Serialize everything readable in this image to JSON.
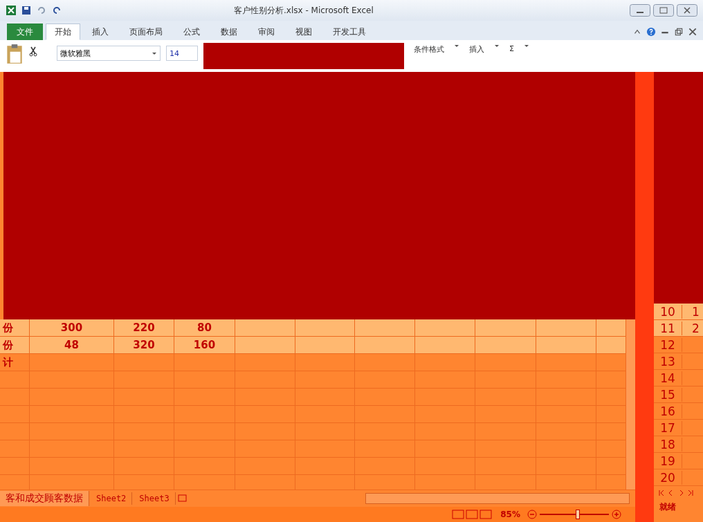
{
  "window": {
    "title": "客户性别分析.xlsx - Microsoft Excel"
  },
  "ribbon_tabs": [
    {
      "label": "文件",
      "kind": "file",
      "selected": false
    },
    {
      "label": "开始",
      "kind": "tab",
      "selected": true
    },
    {
      "label": "插入",
      "kind": "tab",
      "selected": false
    },
    {
      "label": "页面布局",
      "kind": "tab",
      "selected": false
    },
    {
      "label": "公式",
      "kind": "tab",
      "selected": false
    },
    {
      "label": "数据",
      "kind": "tab",
      "selected": false
    },
    {
      "label": "审阅",
      "kind": "tab",
      "selected": false
    },
    {
      "label": "视图",
      "kind": "tab",
      "selected": false
    },
    {
      "label": "开发工具",
      "kind": "tab",
      "selected": false
    }
  ],
  "ribbon": {
    "font": "微软雅黑",
    "font_size": "14",
    "conditional_format": "条件格式",
    "insert": "插入",
    "sum": "Σ"
  },
  "grid_rows": [
    {
      "label": "份",
      "cells": [
        "300",
        "220",
        "80"
      ],
      "selected": true
    },
    {
      "label": "份",
      "cells": [
        "48",
        "320",
        "160"
      ],
      "selected": true
    },
    {
      "label": "计",
      "cells": [],
      "selected": false
    }
  ],
  "side_rows": [
    {
      "number": "10",
      "value": "1",
      "selected": true
    },
    {
      "number": "11",
      "value": "2",
      "selected": true
    },
    {
      "number": "12",
      "selected": false
    },
    {
      "number": "13",
      "selected": false
    },
    {
      "number": "14",
      "selected": false
    },
    {
      "number": "15",
      "selected": false
    },
    {
      "number": "16",
      "selected": false
    },
    {
      "number": "17",
      "selected": false
    },
    {
      "number": "18",
      "selected": false
    },
    {
      "number": "19",
      "selected": false
    },
    {
      "number": "20",
      "selected": false
    }
  ],
  "sheet_tabs": [
    {
      "label": "客和成交顾客数据",
      "selected": true
    },
    {
      "label": "Sheet2",
      "selected": false
    },
    {
      "label": "Sheet3",
      "selected": false
    }
  ],
  "status_bar": {
    "zoom": "85%",
    "zoom_level": {
      "level": 0.55
    },
    "side_status": "就绪"
  }
}
